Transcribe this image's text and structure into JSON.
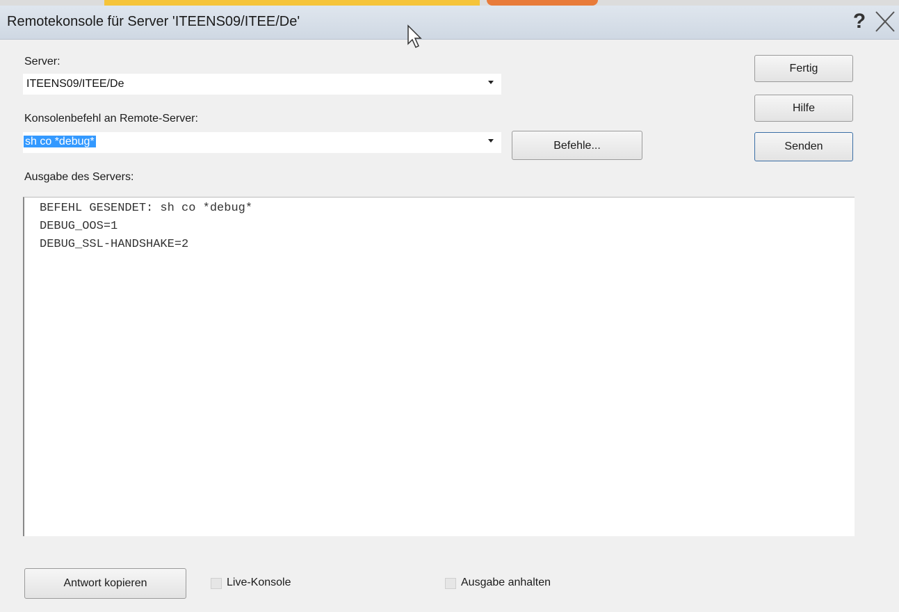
{
  "window": {
    "title": "Remotekonsole für Server 'ITEENS09/ITEE/De'",
    "help_glyph": "?",
    "close_icon": "close-icon"
  },
  "server": {
    "label": "Server:",
    "value": "ITEENS09/ITEE/De"
  },
  "command": {
    "label": "Konsolenbefehl an Remote-Server:",
    "value": "sh co *debug*"
  },
  "buttons": {
    "fertig": "Fertig",
    "hilfe": "Hilfe",
    "senden": "Senden",
    "befehle": "Befehle...",
    "antwort_kopieren": "Antwort kopieren"
  },
  "output": {
    "label": "Ausgabe des Servers:",
    "lines": [
      "BEFEHL GESENDET: sh co *debug*",
      "DEBUG_OOS=1",
      "DEBUG_SSL-HANDSHAKE=2"
    ]
  },
  "options": {
    "live_konsole": {
      "label": "Live-Konsole",
      "checked": false
    },
    "ausgabe_anhalten": {
      "label": "Ausgabe anhalten",
      "checked": false
    }
  }
}
